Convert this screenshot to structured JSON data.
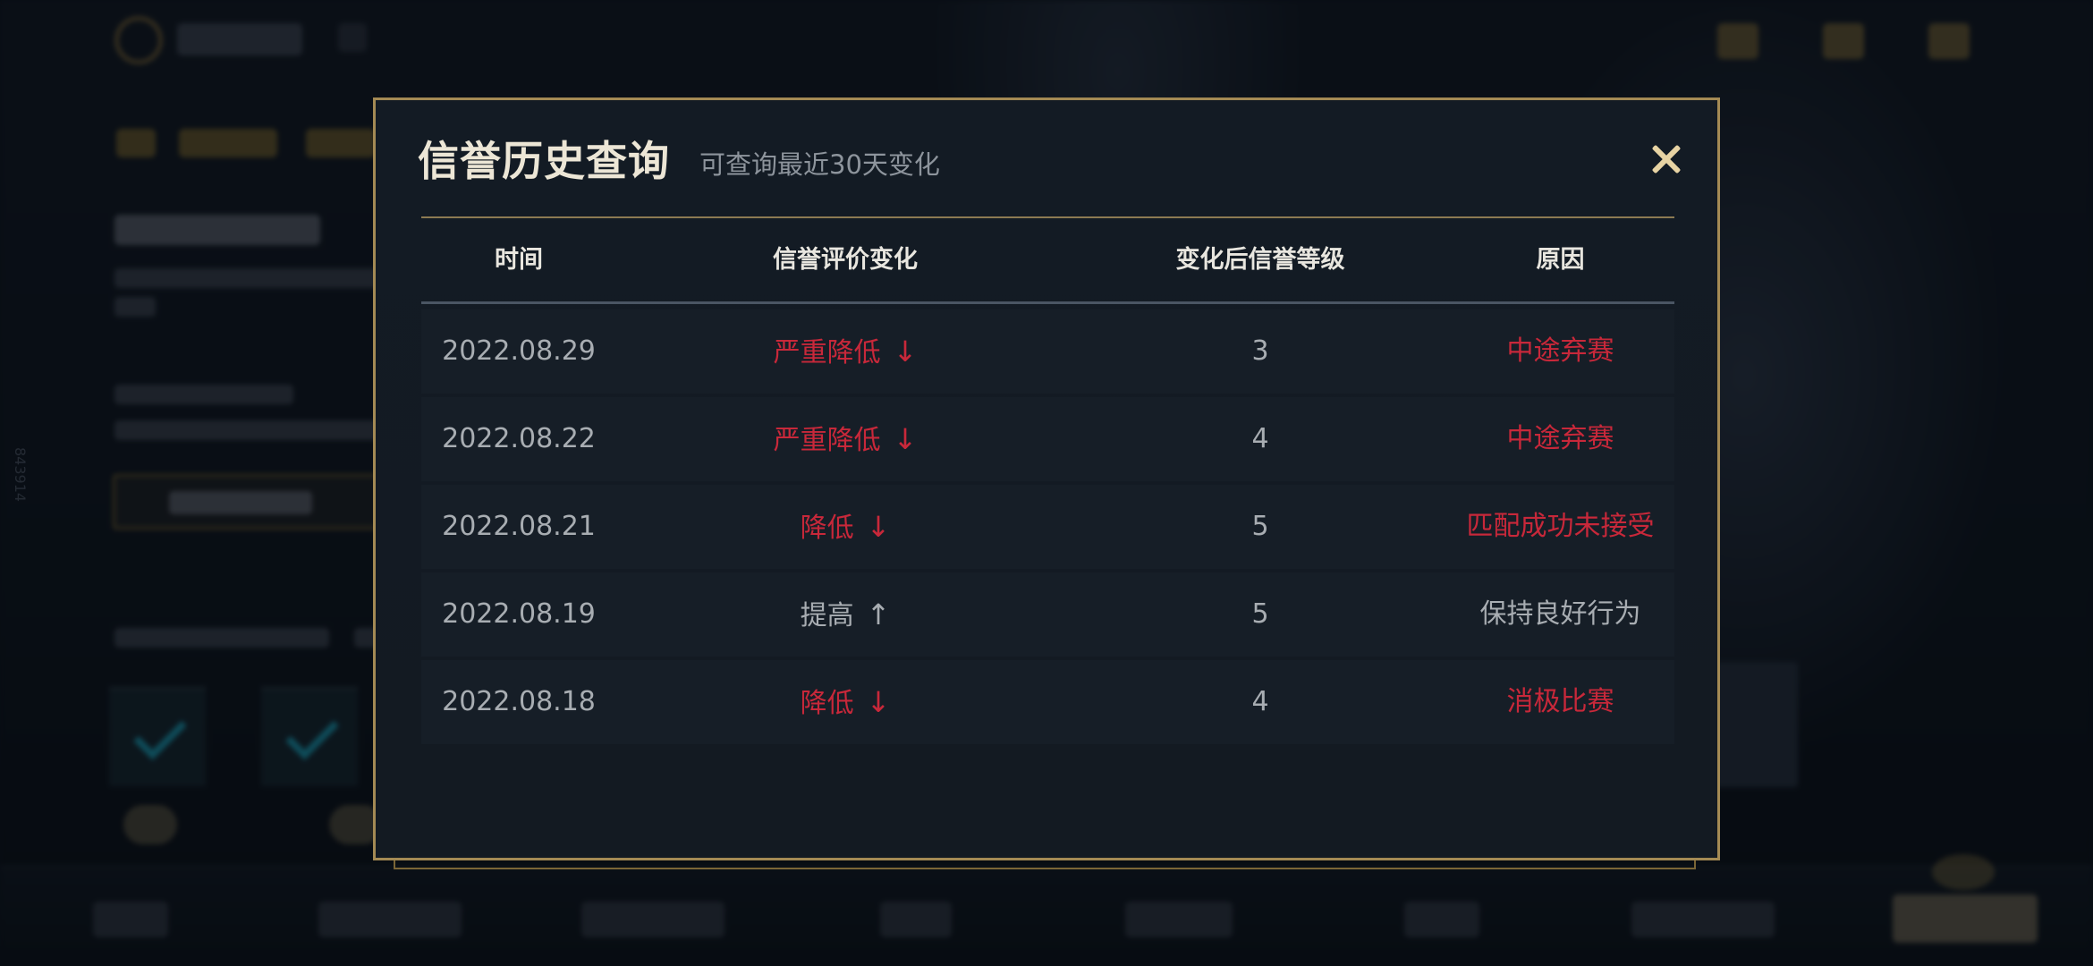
{
  "modal": {
    "title": "信誉历史查询",
    "subtitle": "可查询最近30天变化"
  },
  "table": {
    "headers": [
      "时间",
      "信誉评价变化",
      "变化后信誉等级",
      "原因"
    ],
    "rows": [
      {
        "date": "2022.08.29",
        "change": "严重降低",
        "arrow": "↓",
        "level": "3",
        "reason": "中途弃赛",
        "trend": "down"
      },
      {
        "date": "2022.08.22",
        "change": "严重降低",
        "arrow": "↓",
        "level": "4",
        "reason": "中途弃赛",
        "trend": "down"
      },
      {
        "date": "2022.08.21",
        "change": "降低",
        "arrow": "↓",
        "level": "5",
        "reason": "匹配成功未接受",
        "trend": "down"
      },
      {
        "date": "2022.08.19",
        "change": "提高",
        "arrow": "↑",
        "level": "5",
        "reason": "保持良好行为",
        "trend": "up"
      },
      {
        "date": "2022.08.18",
        "change": "降低",
        "arrow": "↓",
        "level": "4",
        "reason": "消极比赛",
        "trend": "down"
      }
    ]
  },
  "background": {
    "side_text": "843914"
  },
  "colors": {
    "accent_gold": "#a48a54",
    "negative_red": "#c8283a",
    "neutral_gray": "#a8adb2"
  }
}
